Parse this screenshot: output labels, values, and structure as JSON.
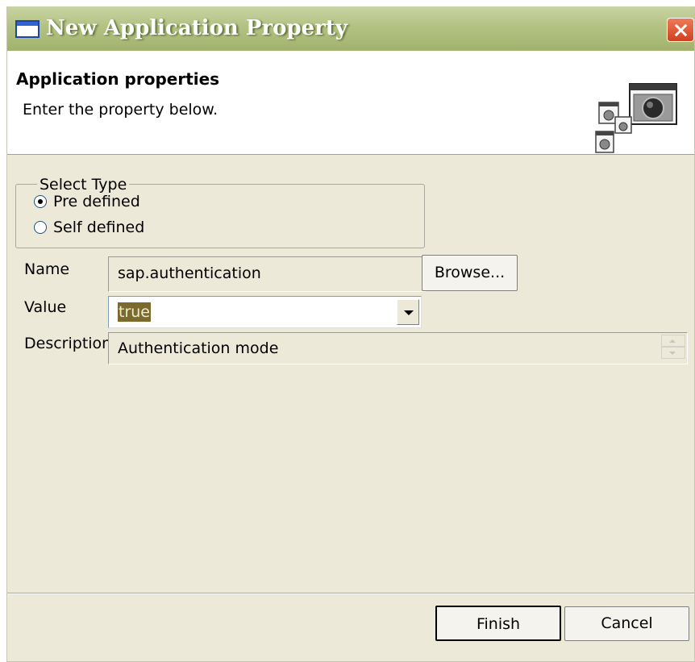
{
  "window": {
    "title": "New Application Property",
    "icon": "window-icon",
    "close_icon": "close-icon"
  },
  "header": {
    "title": "Application properties",
    "description": "Enter the property below.",
    "icon": "wizard-graphic-icon"
  },
  "select_type": {
    "legend": "Select Type",
    "options": [
      {
        "label": "Pre defined",
        "checked": true
      },
      {
        "label": "Self defined",
        "checked": false
      }
    ]
  },
  "form": {
    "name_label": "Name",
    "name_value": "sap.authentication",
    "browse_label": "Browse...",
    "value_label": "Value",
    "value_value": "true",
    "description_label": "Description",
    "description_value": "Authentication mode"
  },
  "footer": {
    "finish_label": "Finish",
    "cancel_label": "Cancel"
  }
}
